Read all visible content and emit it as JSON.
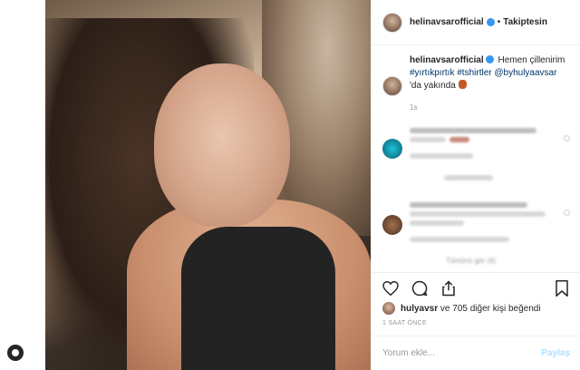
{
  "header": {
    "username": "helinavsarofficial",
    "separator": "•",
    "follow_status": "Takiptesin"
  },
  "caption": {
    "username": "helinavsarofficial",
    "text_start": "Hemen çillenirim",
    "hashtag_1": "#yırtıkpırtık",
    "hashtag_2": "#tshirtler",
    "mention": "@byhulyaavsar",
    "text_end": "'da yakında",
    "time": "1s"
  },
  "blurred_comments": {
    "load_more": "Tümünü gör (4)"
  },
  "actions": {
    "like_icon": "heart-icon",
    "comment_icon": "comment-icon",
    "share_icon": "share-icon",
    "save_icon": "bookmark-icon"
  },
  "likes": {
    "user": "hulyavsr",
    "text": "ve 705 diğer kişi beğendi"
  },
  "date": "1 SAAT ÖNCE",
  "comment_input": {
    "placeholder": "Yorum ekle...",
    "post_label": "Paylaş"
  },
  "colors": {
    "verified": "#3897f0",
    "link": "#003569",
    "post_disabled": "#b2dffc"
  }
}
